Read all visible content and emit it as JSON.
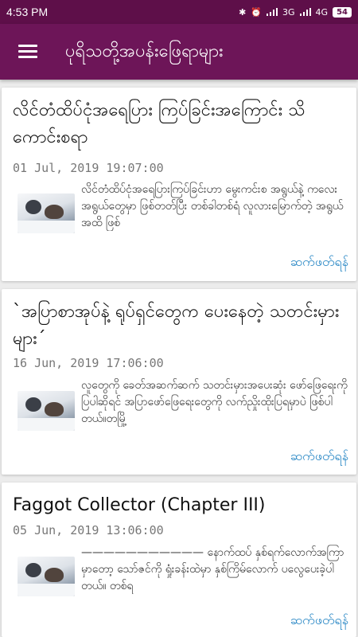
{
  "status_bar": {
    "time": "4:53 PM",
    "network": "3G",
    "network2": "4G",
    "battery": "54"
  },
  "app_bar": {
    "title": "ပုရိသတို့အပန်းဖြေရာများ"
  },
  "posts": [
    {
      "title": "လိင်တံထိပ်ငုံအရေပြား ကြပ်ခြင်းအကြောင်း သိကောင်းစရာ",
      "date": "01 Jul, 2019 19:07:00",
      "excerpt": "လိင်တံထိပ်ငုံအရေပြားကြပ်ခြင်းဟာ မွေးကင်းစ အရွယ်နဲ့ ကလေး အရွယ်တွေမှာ ဖြစ်တတ်ပြီး တစ်ခါတစ်ရံ လူလားမြောက်တဲ့ အရွယ်အထိ ဖြစ်",
      "read_more": "ဆက်ဖတ်ရန်"
    },
    {
      "title": "`အပြာစာအုပ်နဲ့ ရုပ်ရှင်တွေက ပေးနေတဲ့ သတင်းမှားများ´",
      "date": "16 Jun, 2019 17:06:00",
      "excerpt": "လူတွေကို ခေတ်အဆက်ဆက် သတင်းမှားအပေးဆုံး ဖော်ဖြေရေးကို ပြပါဆိုရင် အပြာဖော်ဖြေရေးတွေကို လက်ညှိုးထိုးပြရမှာပဲ ဖြစ်ပါတယ်။တမြို့",
      "read_more": "ဆက်ဖတ်ရန်"
    },
    {
      "title": "Faggot Collector (Chapter III)",
      "date": "05 Jun, 2019 13:06:00",
      "excerpt": "——————————— နောက်ထပ် နှစ်ရက်လောက်အကြာမှာတော့ သော်ဇင်ကို ရှုံးခန်းထဲမှာ နှစ်ကြိမ်လောက် ပလွေပေးခဲ့ပါတယ်။ တစ်ရ",
      "read_more": "ဆက်ဖတ်ရန်"
    }
  ]
}
